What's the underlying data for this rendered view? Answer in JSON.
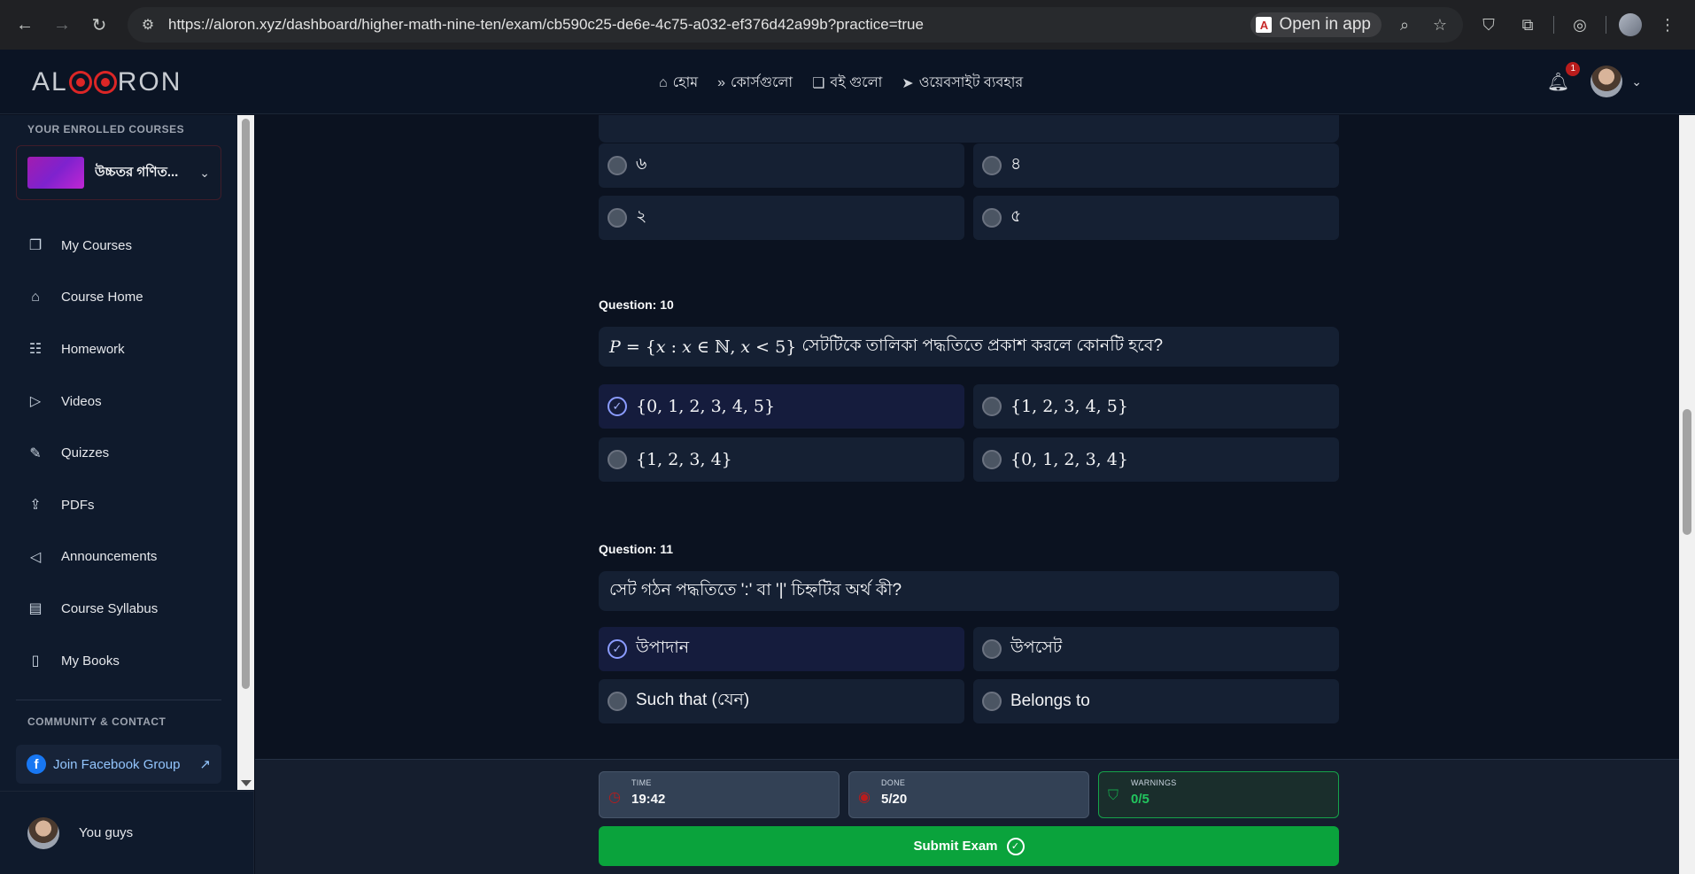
{
  "browser": {
    "url": "https://aloron.xyz/dashboard/higher-math-nine-ten/exam/cb590c25-de6e-4c75-a032-ef376d42a99b?practice=true",
    "open_in_app": "Open in app"
  },
  "header": {
    "logo": "ALORON",
    "nav": [
      {
        "label": "হোম",
        "icon": "home-icon"
      },
      {
        "label": "কোর্সগুলো",
        "icon": "fast-forward-icon"
      },
      {
        "label": "বই গুলো",
        "icon": "book-open-icon"
      },
      {
        "label": "ওয়েবসাইট ব্যবহার",
        "icon": "send-icon"
      }
    ],
    "notification_count": "1"
  },
  "sidebar": {
    "enrolled_heading": "YOUR ENROLLED COURSES",
    "course_name": "উচ্চতর গণিত...",
    "items": [
      {
        "label": "My Courses",
        "icon": "book-icon"
      },
      {
        "label": "Course Home",
        "icon": "home-icon"
      },
      {
        "label": "Homework",
        "icon": "clipboard-icon"
      },
      {
        "label": "Videos",
        "icon": "play-circle-icon"
      },
      {
        "label": "Quizzes",
        "icon": "pen-tool-icon"
      },
      {
        "label": "PDFs",
        "icon": "file-upload-icon"
      },
      {
        "label": "Announcements",
        "icon": "megaphone-icon"
      },
      {
        "label": "Course Syllabus",
        "icon": "file-text-icon"
      },
      {
        "label": "My Books",
        "icon": "book-closed-icon"
      }
    ],
    "community_heading": "COMMUNITY & CONTACT",
    "facebook_label": "Join Facebook Group",
    "user_name": "You guys"
  },
  "exam": {
    "prev_options": [
      "৬",
      "৪",
      "২",
      "৫"
    ],
    "q10": {
      "label": "Question: 10",
      "text": "সেটটিকে তালিকা পদ্ধতিতে প্রকাশ করলে কোনটি হবে?",
      "options": [
        "{0, 1, 2, 3, 4, 5}",
        "{1, 2, 3, 4, 5}",
        "{1, 2, 3, 4}",
        "{0, 1, 2, 3, 4}"
      ],
      "selected": 0
    },
    "q11": {
      "label": "Question: 11",
      "text": "সেট গঠন পদ্ধতিতে ':' বা '|' চিহ্নটির অর্থ কী?",
      "options": [
        "উপাদান",
        "উপসেট",
        "Such that (যেন)",
        "Belongs to"
      ],
      "selected": 0
    }
  },
  "footer": {
    "time_label": "TIME",
    "time_value": "19:42",
    "done_label": "DONE",
    "done_value": "5/20",
    "warnings_label": "WARNINGS",
    "warnings_value": "0/5",
    "submit_label": "Submit Exam"
  }
}
